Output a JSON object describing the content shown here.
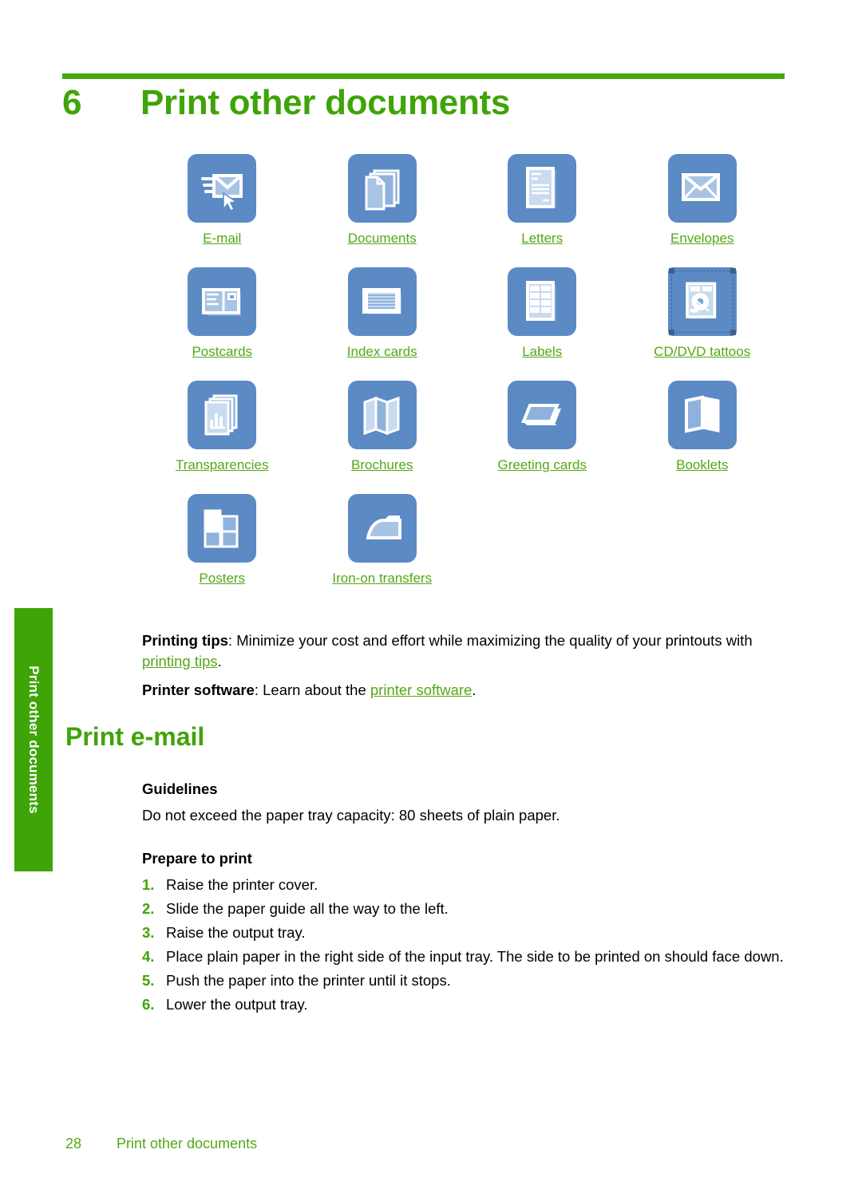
{
  "side_tab": {
    "label": "Print other documents"
  },
  "chapter": {
    "number": "6",
    "title": "Print other documents"
  },
  "icon_grid": {
    "rows": [
      [
        {
          "label": "E-mail",
          "icon": "email-with-cursor-icon"
        },
        {
          "label": "Documents",
          "icon": "stacked-documents-icon"
        },
        {
          "label": "Letters",
          "icon": "letter-page-icon"
        },
        {
          "label": "Envelopes",
          "icon": "envelope-icon"
        }
      ],
      [
        {
          "label": "Postcards",
          "icon": "postcard-icon"
        },
        {
          "label": "Index cards",
          "icon": "index-card-icon"
        },
        {
          "label": "Labels",
          "icon": "label-sheet-icon"
        },
        {
          "label": "CD/DVD tattoos",
          "icon": "cd-dvd-tattoo-icon"
        }
      ],
      [
        {
          "label": "Transparencies",
          "icon": "transparency-chart-icon"
        },
        {
          "label": "Brochures",
          "icon": "folded-brochure-icon"
        },
        {
          "label": "Greeting cards",
          "icon": "greeting-card-icon"
        },
        {
          "label": "Booklets",
          "icon": "booklet-icon"
        }
      ],
      [
        {
          "label": "Posters",
          "icon": "poster-tiles-icon"
        },
        {
          "label": "Iron-on transfers",
          "icon": "iron-icon"
        }
      ]
    ]
  },
  "intro": {
    "printing_tips_label": "Printing tips",
    "printing_tips_text_1": ": Minimize your cost and effort while maximizing the quality of your printouts with ",
    "printing_tips_link": "printing tips",
    "printing_tips_text_2": ".",
    "printer_software_label": "Printer software",
    "printer_software_text_1": ": Learn about the ",
    "printer_software_link": "printer software",
    "printer_software_text_2": "."
  },
  "section": {
    "title": "Print e-mail",
    "guidelines_head": "Guidelines",
    "guidelines_text": "Do not exceed the paper tray capacity: 80 sheets of plain paper.",
    "prepare_head": "Prepare to print",
    "steps": [
      {
        "num": "1.",
        "text": "Raise the printer cover."
      },
      {
        "num": "2.",
        "text": "Slide the paper guide all the way to the left."
      },
      {
        "num": "3.",
        "text": "Raise the output tray."
      },
      {
        "num": "4.",
        "text": "Place plain paper in the right side of the input tray. The side to be printed on should face down."
      },
      {
        "num": "5.",
        "text": "Push the paper into the printer until it stops."
      },
      {
        "num": "6.",
        "text": "Lower the output tray."
      }
    ]
  },
  "footer": {
    "page_number": "28",
    "chapter_name": "Print other documents"
  },
  "colors": {
    "green_heading": "#3fa408",
    "green_link": "#55a716",
    "tile_blue": "#5b8ac5",
    "glyph_light": "#a8c3e4"
  }
}
